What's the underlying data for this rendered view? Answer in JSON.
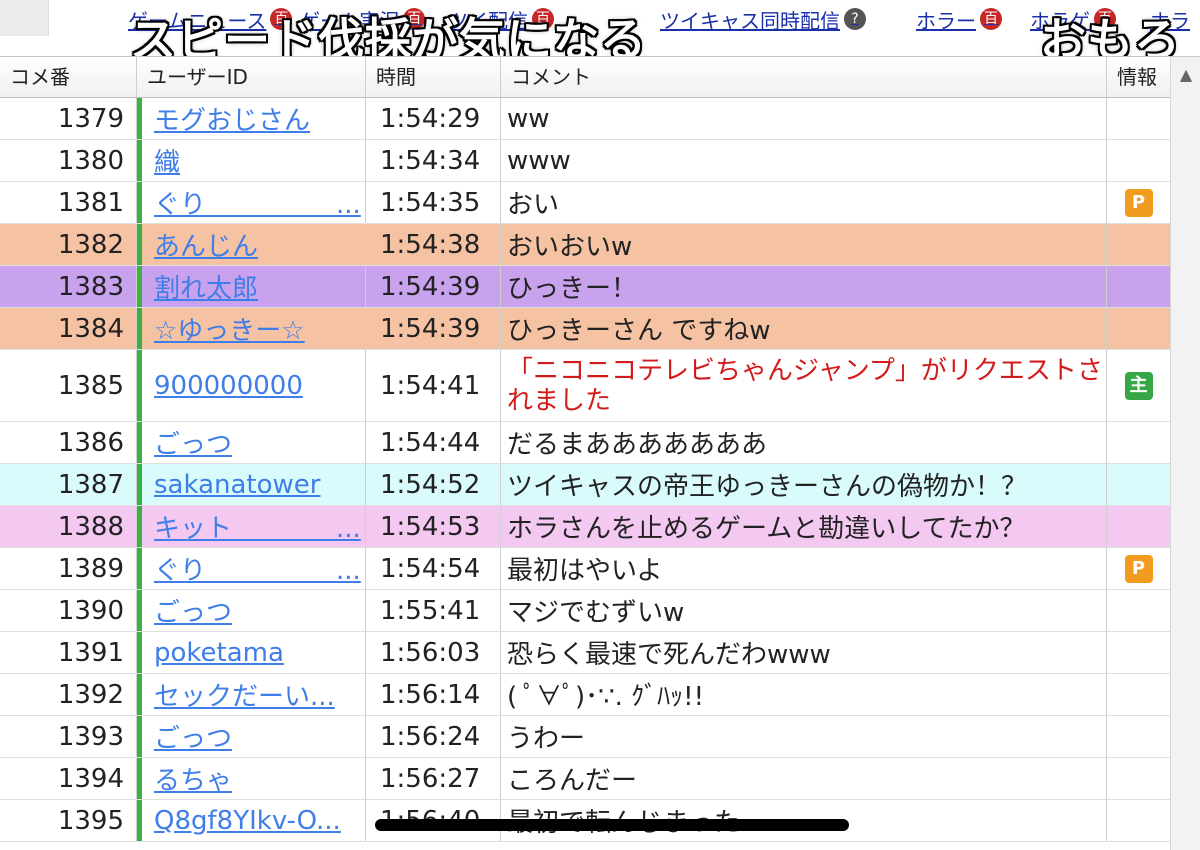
{
  "tags": [
    {
      "label": "ゲームニュース",
      "badge": "百"
    },
    {
      "label": "ゲーム実況",
      "badge": "百"
    },
    {
      "label": "ツイ配信",
      "badge": "百"
    },
    {
      "label": "ツイキャス同時配信",
      "badge": "?"
    },
    {
      "label": "ホラー",
      "badge": "百"
    },
    {
      "label": "ホラゲ",
      "badge": "百"
    },
    {
      "label": "ホラ"
    }
  ],
  "caption": {
    "main": "スピード伐採が気になる",
    "right": "おもろ"
  },
  "columns": {
    "no": "コメ番",
    "user": "ユーザーID",
    "time": "時間",
    "comment": "コメント",
    "info": "情報"
  },
  "colors": {
    "orange_row": "#f6c2a4",
    "purple_row": "#c9a2ee",
    "cyan_row": "#d9fbfb",
    "pink_row": "#f3c8f1",
    "user_link": "#3f7ee8",
    "badge_premium": "#f29c1f",
    "badge_owner": "#35a845"
  },
  "rows": [
    {
      "no": "1379",
      "user": "モグおじさん",
      "time": "1:54:29",
      "comment": "ww"
    },
    {
      "no": "1380",
      "user": "織",
      "time": "1:54:34",
      "comment": "www"
    },
    {
      "no": "1381",
      "user": "ぐり　　　　　...",
      "time": "1:54:35",
      "comment": "おい",
      "info": "P"
    },
    {
      "no": "1382",
      "user": "あんじん",
      "time": "1:54:38",
      "comment": "おいおいw",
      "bg": "orange"
    },
    {
      "no": "1383",
      "user": "割れ太郎",
      "time": "1:54:39",
      "comment": "ひっきー！",
      "bg": "purple"
    },
    {
      "no": "1384",
      "user": "☆ゆっきー☆",
      "time": "1:54:39",
      "comment": "ひっきーさん ですねw",
      "bg": "orange"
    },
    {
      "no": "1385",
      "user": "900000000",
      "time": "1:54:41",
      "comment": "「ニコニコテレビちゃんジャンプ」がリクエストされました",
      "info": "主",
      "red": true
    },
    {
      "no": "1386",
      "user": "ごっつ",
      "time": "1:54:44",
      "comment": "だるまあああああああ"
    },
    {
      "no": "1387",
      "user": "sakanatower",
      "time": "1:54:52",
      "comment": "ツイキャスの帝王ゆっきーさんの偽物か！？",
      "bg": "cyan"
    },
    {
      "no": "1388",
      "user": "キット　　　　...",
      "time": "1:54:53",
      "comment": "ホラさんを止めるゲームと勘違いしてたか？",
      "bg": "pink"
    },
    {
      "no": "1389",
      "user": "ぐり　　　　　...",
      "time": "1:54:54",
      "comment": "最初はやいよ",
      "info": "P"
    },
    {
      "no": "1390",
      "user": "ごっつ",
      "time": "1:55:41",
      "comment": "マジでむずいw"
    },
    {
      "no": "1391",
      "user": "poketama",
      "time": "1:56:03",
      "comment": "恐らく最速で死んだわwww"
    },
    {
      "no": "1392",
      "user": "セックだーい...",
      "time": "1:56:14",
      "comment": "( ﾟ∀ﾟ)･∵. ｸﾞﾊｯ!!"
    },
    {
      "no": "1393",
      "user": "ごっつ",
      "time": "1:56:24",
      "comment": "うわー"
    },
    {
      "no": "1394",
      "user": "るちゃ",
      "time": "1:56:27",
      "comment": "ころんだー"
    },
    {
      "no": "1395",
      "user": "Q8gf8YIkv-O...",
      "time": "1:56:40",
      "comment": "最初で転んじまった"
    }
  ]
}
